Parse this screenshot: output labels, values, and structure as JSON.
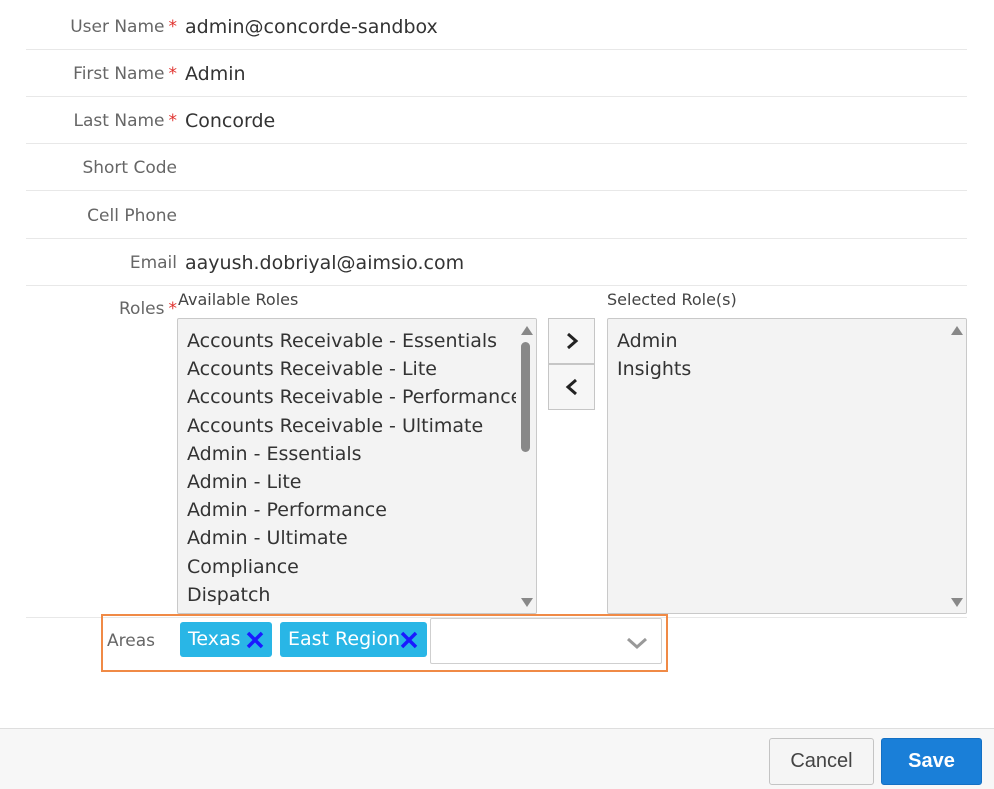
{
  "fields": {
    "user_name": {
      "label": "User Name",
      "value": "admin@concorde-sandbox",
      "required": "*"
    },
    "first_name": {
      "label": "First Name",
      "value": "Admin",
      "required": "*"
    },
    "last_name": {
      "label": "Last Name",
      "value": "Concorde",
      "required": "*"
    },
    "short_code": {
      "label": "Short Code",
      "value": ""
    },
    "cell_phone": {
      "label": "Cell Phone",
      "value": ""
    },
    "email": {
      "label": "Email",
      "value": "aayush.dobriyal@aimsio.com"
    }
  },
  "roles": {
    "label": "Roles",
    "required": "*",
    "available_title": "Available Roles",
    "selected_title": "Selected Role(s)",
    "available": [
      "Accounts Receivable - Essentials",
      "Accounts Receivable - Lite",
      "Accounts Receivable - Performance",
      "Accounts Receivable - Ultimate",
      "Admin - Essentials",
      "Admin - Lite",
      "Admin - Performance",
      "Admin - Ultimate",
      "Compliance",
      "Dispatch"
    ],
    "selected": [
      "Admin",
      "Insights"
    ],
    "add_icon": "chevron-right-icon",
    "remove_icon": "chevron-left-icon"
  },
  "areas": {
    "label": "Areas",
    "tags": [
      {
        "label": "Texas"
      },
      {
        "label": "East Region"
      }
    ],
    "dropdown_value": "",
    "highlight_color": "#f08a46",
    "tag_color": "#29b6e6",
    "remove_icon_color": "#1a1aff"
  },
  "footer": {
    "cancel_label": "Cancel",
    "save_label": "Save",
    "save_color": "#1a7fd8"
  }
}
